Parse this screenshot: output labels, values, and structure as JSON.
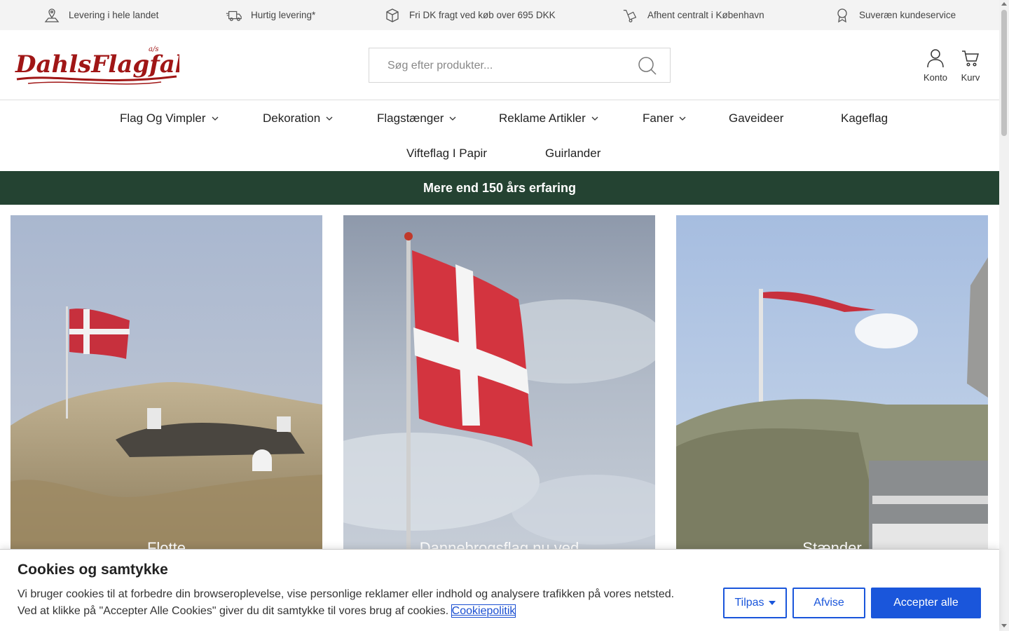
{
  "usp_bar": {
    "items": [
      {
        "label": "Levering i hele landet",
        "icon": "map-pin-icon"
      },
      {
        "label": "Hurtig levering*",
        "icon": "truck-icon"
      },
      {
        "label": "Fri DK fragt ved køb over 695 DKK",
        "icon": "box-icon"
      },
      {
        "label": "Afhent centralt i København",
        "icon": "hand-truck-icon"
      },
      {
        "label": "Suveræn kundeservice",
        "icon": "award-icon"
      }
    ]
  },
  "header": {
    "logo_text": "DahlsFlagfabrik",
    "logo_suffix": "a/s",
    "search_placeholder": "Søg efter produkter...",
    "account_label": "Konto",
    "cart_label": "Kurv"
  },
  "nav": {
    "items": [
      {
        "label": "Flag Og Vimpler",
        "has_dropdown": true
      },
      {
        "label": "Dekoration",
        "has_dropdown": true
      },
      {
        "label": "Flagstænger",
        "has_dropdown": true
      },
      {
        "label": "Reklame Artikler",
        "has_dropdown": true
      },
      {
        "label": "Faner",
        "has_dropdown": true
      },
      {
        "label": "Gaveideer",
        "has_dropdown": false
      },
      {
        "label": "Kageflag",
        "has_dropdown": false
      },
      {
        "label": "Vifteflag I Papir",
        "has_dropdown": false
      },
      {
        "label": "Guirlander",
        "has_dropdown": false
      }
    ]
  },
  "banner": {
    "text": "Mere end 150 års erfaring",
    "color": "#244332"
  },
  "categories": [
    {
      "label": "Flotte"
    },
    {
      "label": "Dannebrogsflag nu ved"
    },
    {
      "label": "Stænder"
    }
  ],
  "cookie": {
    "title": "Cookies og samtykke",
    "text_line1": "Vi bruger cookies til at forbedre din browseroplevelse, vise personlige reklamer eller indhold og analysere trafikken på vores netsted.",
    "text_line2": "Ved at klikke på \"Accepter Alle Cookies\" giver du dit samtykke til vores brug af cookies.",
    "policy_link": "Cookiepolitik",
    "customize_label": "Tilpas",
    "reject_label": "Afvise",
    "accept_label": "Accepter alle",
    "accent_color": "#1a56db"
  },
  "colors": {
    "brand_red": "#a01616",
    "usp_bg": "#f3f3f3"
  }
}
